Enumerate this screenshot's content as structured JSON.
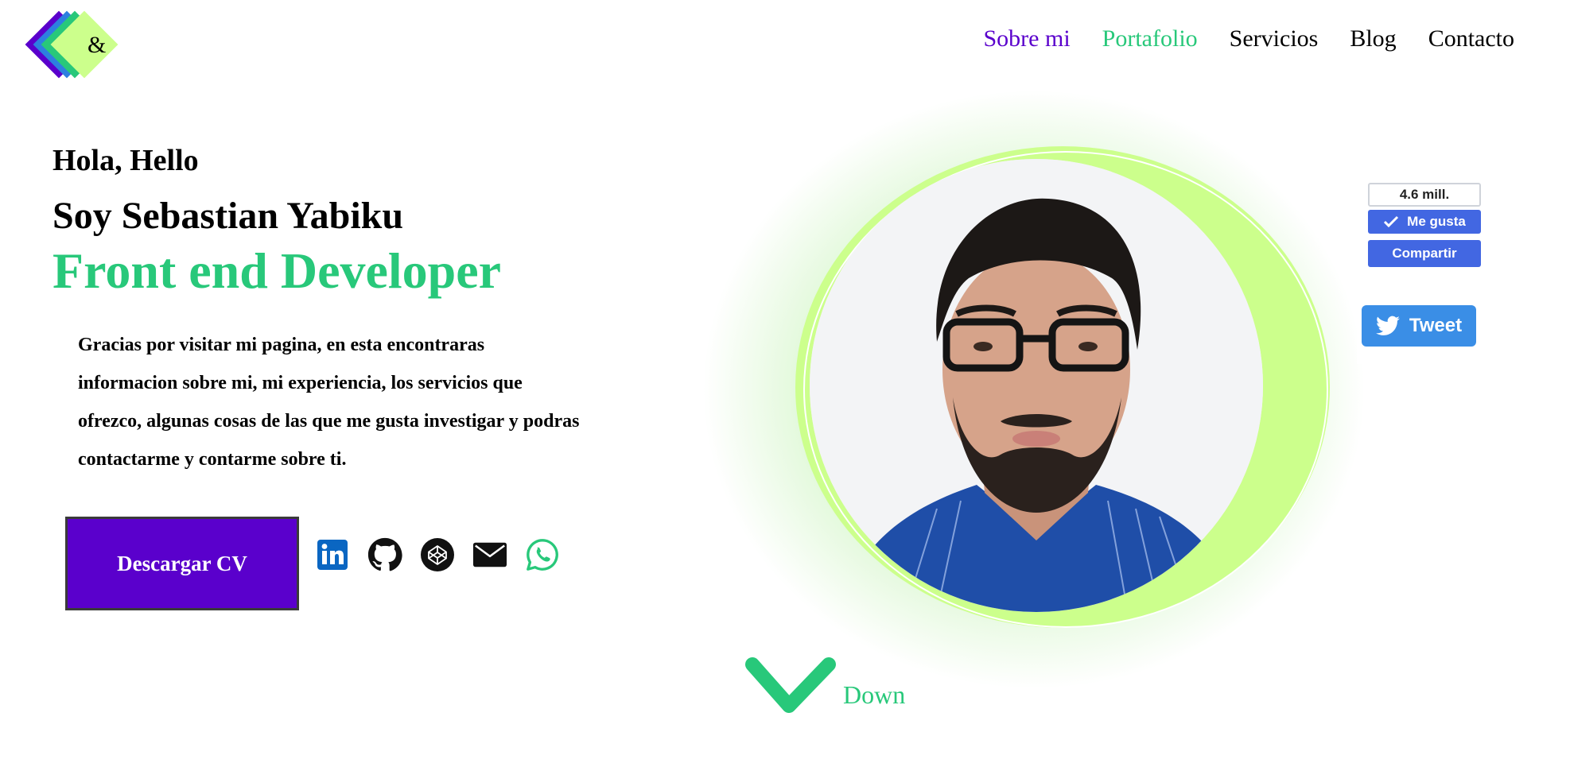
{
  "logo": {
    "glyph": "&"
  },
  "nav": {
    "items": [
      {
        "label": "Sobre mi",
        "color": "#5a00cc"
      },
      {
        "label": "Portafolio",
        "color": "#28c87a"
      },
      {
        "label": "Servicios"
      },
      {
        "label": "Blog"
      },
      {
        "label": "Contacto"
      }
    ]
  },
  "hero": {
    "greeting": "Hola, Hello",
    "name": "Soy Sebastian Yabiku",
    "role": "Front end Developer",
    "description": "Gracias por visitar mi pagina, en esta encontraras informacion sobre mi, mi experiencia, los servicios que ofrezco, algunas cosas de las que me gusta investigar y podras contactarme y contarme sobre ti.",
    "cv_button": "Descargar CV"
  },
  "social": [
    {
      "icon": "linkedin-icon"
    },
    {
      "icon": "github-icon"
    },
    {
      "icon": "codepen-icon"
    },
    {
      "icon": "email-icon"
    },
    {
      "icon": "whatsapp-icon"
    }
  ],
  "share": {
    "fb_count": "4.6 mill.",
    "fb_like": "Me gusta",
    "fb_share": "Compartir",
    "tweet": "Tweet"
  },
  "scroll": {
    "label": "Down"
  },
  "colors": {
    "accent_purple": "#5a00cc",
    "accent_green": "#28c87a",
    "ring_lime": "#ccff8c",
    "facebook_blue": "#4267e2",
    "twitter_blue": "#3a8ee6"
  }
}
